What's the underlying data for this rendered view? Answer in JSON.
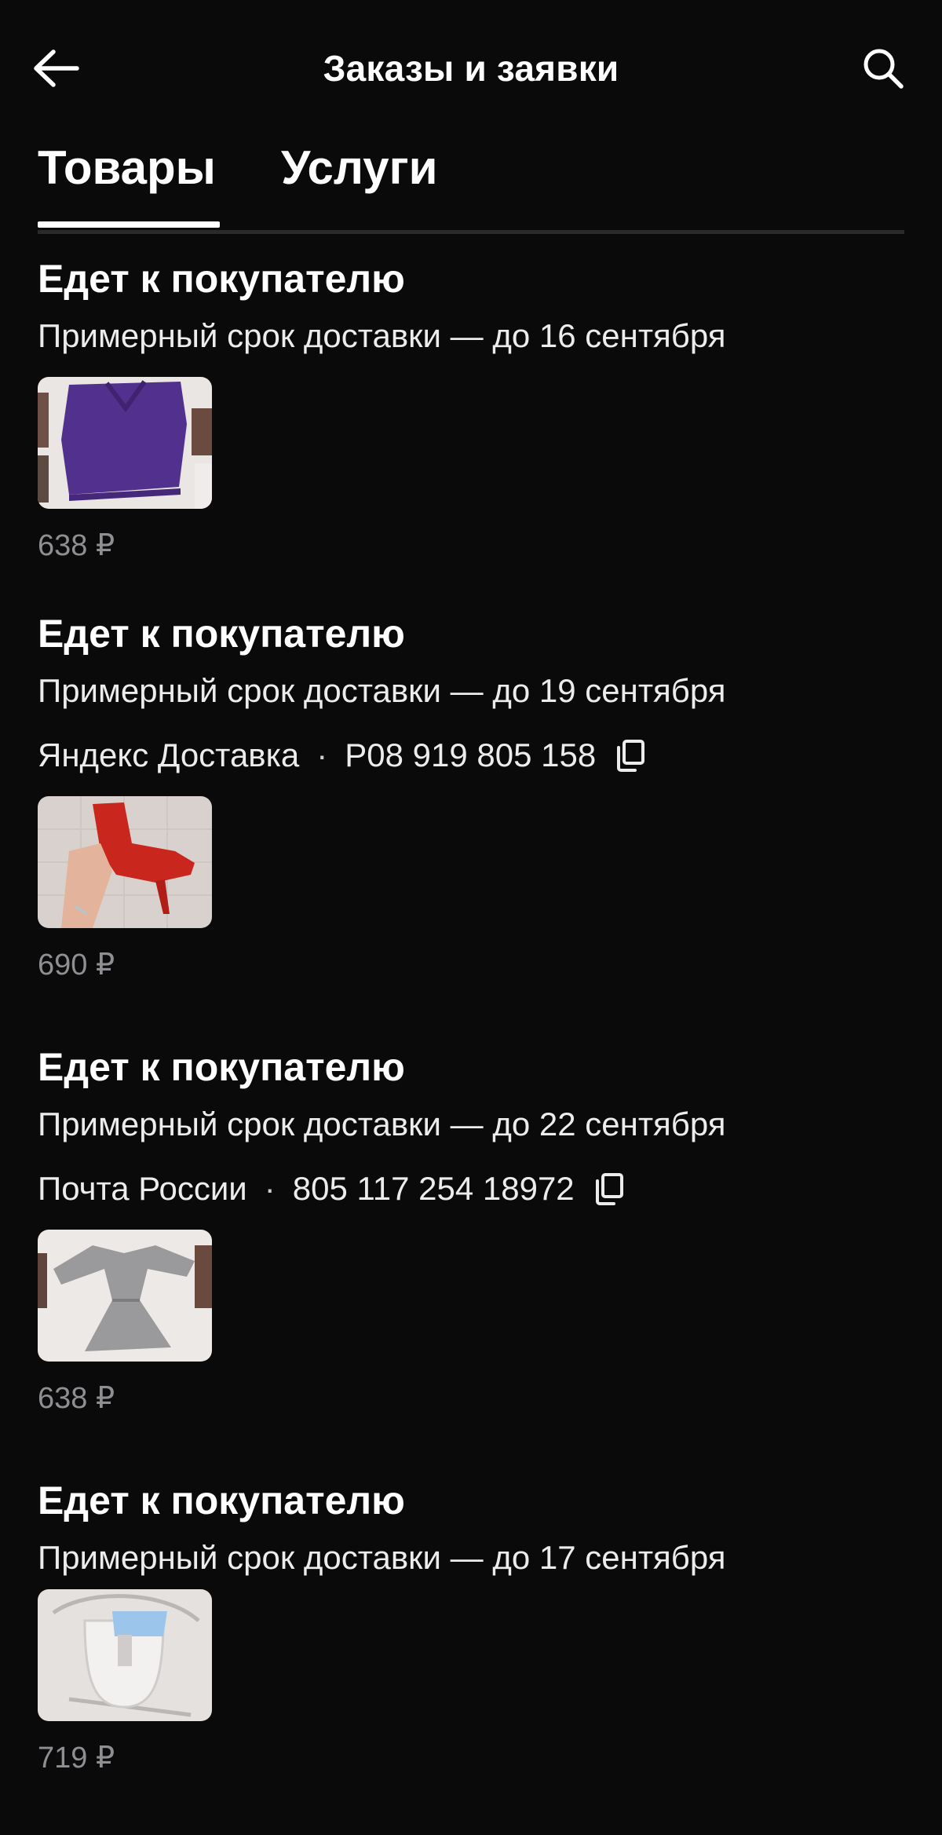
{
  "header": {
    "title": "Заказы и заявки",
    "back_icon": "arrow-left-icon",
    "search_icon": "search-icon"
  },
  "tabs": [
    {
      "label": "Товары",
      "active": true
    },
    {
      "label": "Услуги",
      "active": false
    }
  ],
  "orders": [
    {
      "status": "Едет к покупателю",
      "eta": "Примерный срок доставки — до 16 сентября",
      "image": "purple-sweater",
      "price": "638 ₽"
    },
    {
      "status": "Едет к покупателю",
      "eta": "Примерный срок доставки — до 19 сентября",
      "carrier": "Яндекс Доставка",
      "tracking_number": "Р08 919 805 158",
      "image": "red-high-heel-boot",
      "price": "690 ₽"
    },
    {
      "status": "Едет к покупателю",
      "eta": "Примерный срок доставки — до 22 сентября",
      "carrier": "Почта России",
      "tracking_number": "805 117 254 18972",
      "image": "grey-knit-dress",
      "price": "638 ₽"
    },
    {
      "status": "Едет к покупателю",
      "eta": "Примерный срок доставки — до 17 сентября",
      "image": "white-blue-handbag",
      "price": "719 ₽"
    }
  ],
  "colors": {
    "background": "#0a0a0b",
    "text": "#ffffff",
    "muted": "#8f8f93"
  }
}
